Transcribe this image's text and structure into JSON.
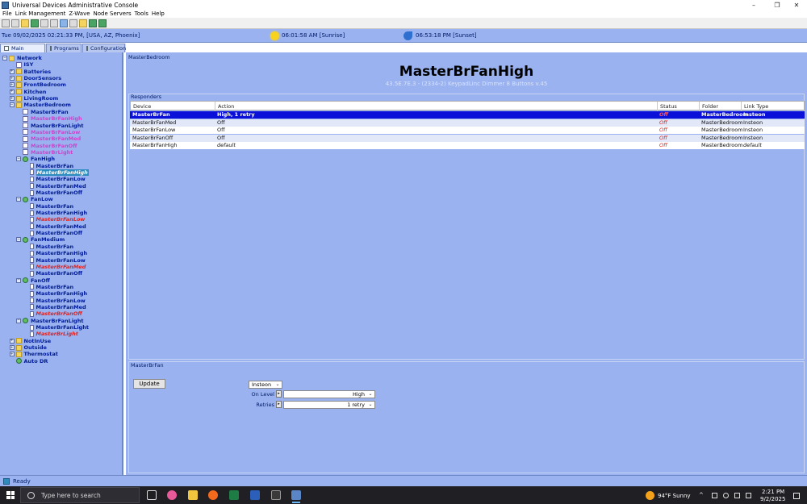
{
  "window": {
    "title": "Universal Devices Administrative Console",
    "controls": [
      "–",
      "❐",
      "✕"
    ]
  },
  "menu": [
    "File",
    "Link Management",
    "Z-Wave",
    "Node Servers",
    "Tools",
    "Help"
  ],
  "infobar": {
    "datetime": "Tue 09/02/2025 02:21:33 PM, [USA, AZ, Phoenix]",
    "sunrise": "06:01:58 AM [Sunrise]",
    "sunset": "06:53:18 PM [Sunset]"
  },
  "tabs": [
    "Main",
    "Programs",
    "Configuration"
  ],
  "tree": [
    {
      "label": "Network",
      "indent": 0,
      "toggle": "−",
      "icon": "net",
      "style": "normal"
    },
    {
      "label": "ISY",
      "indent": 1,
      "toggle": "",
      "icon": "dev",
      "style": "normal"
    },
    {
      "label": "Batteries",
      "indent": 1,
      "toggle": "+",
      "icon": "folder",
      "style": "normal"
    },
    {
      "label": "DoorSensors",
      "indent": 1,
      "toggle": "+",
      "icon": "folder",
      "style": "normal"
    },
    {
      "label": "FrontBedroom",
      "indent": 1,
      "toggle": "+",
      "icon": "folder",
      "style": "normal"
    },
    {
      "label": "Kitchen",
      "indent": 1,
      "toggle": "+",
      "icon": "folder",
      "style": "normal"
    },
    {
      "label": "LivingRoom",
      "indent": 1,
      "toggle": "+",
      "icon": "folder",
      "style": "normal"
    },
    {
      "label": "MasterBedroom",
      "indent": 1,
      "toggle": "−",
      "icon": "folder",
      "style": "normal"
    },
    {
      "label": "MasterBrFan",
      "indent": 2,
      "toggle": "",
      "icon": "dev",
      "style": "normal"
    },
    {
      "label": "MasterBrFanHigh",
      "indent": 2,
      "toggle": "",
      "icon": "dev",
      "style": "pink"
    },
    {
      "label": "MasterBrFanLight",
      "indent": 2,
      "toggle": "",
      "icon": "dev",
      "style": "normal"
    },
    {
      "label": "MasterBrFanLow",
      "indent": 2,
      "toggle": "",
      "icon": "dev",
      "style": "pink"
    },
    {
      "label": "MasterBrFanMed",
      "indent": 2,
      "toggle": "",
      "icon": "dev",
      "style": "pink"
    },
    {
      "label": "MasterBrFanOff",
      "indent": 2,
      "toggle": "",
      "icon": "dev",
      "style": "pink"
    },
    {
      "label": "MasterBrLight",
      "indent": 2,
      "toggle": "",
      "icon": "dev",
      "style": "pink"
    },
    {
      "label": "FanHigh",
      "indent": 2,
      "toggle": "−",
      "icon": "scene",
      "style": "normal"
    },
    {
      "label": "MasterBrFan",
      "indent": 3,
      "toggle": "",
      "icon": "small",
      "style": "normal"
    },
    {
      "label": "MasterBrFanHigh",
      "indent": 3,
      "toggle": "",
      "icon": "small",
      "style": "sel"
    },
    {
      "label": "MasterBrFanLow",
      "indent": 3,
      "toggle": "",
      "icon": "small",
      "style": "normal"
    },
    {
      "label": "MasterBrFanMed",
      "indent": 3,
      "toggle": "",
      "icon": "small",
      "style": "normal"
    },
    {
      "label": "MasterBrFanOff",
      "indent": 3,
      "toggle": "",
      "icon": "small",
      "style": "normal"
    },
    {
      "label": "FanLow",
      "indent": 2,
      "toggle": "−",
      "icon": "scene",
      "style": "normal"
    },
    {
      "label": "MasterBrFan",
      "indent": 3,
      "toggle": "",
      "icon": "small",
      "style": "normal"
    },
    {
      "label": "MasterBrFanHigh",
      "indent": 3,
      "toggle": "",
      "icon": "small",
      "style": "normal"
    },
    {
      "label": "MasterBrFanLow",
      "indent": 3,
      "toggle": "",
      "icon": "small",
      "style": "red"
    },
    {
      "label": "MasterBrFanMed",
      "indent": 3,
      "toggle": "",
      "icon": "small",
      "style": "normal"
    },
    {
      "label": "MasterBrFanOff",
      "indent": 3,
      "toggle": "",
      "icon": "small",
      "style": "normal"
    },
    {
      "label": "FanMedium",
      "indent": 2,
      "toggle": "−",
      "icon": "scene",
      "style": "normal"
    },
    {
      "label": "MasterBrFan",
      "indent": 3,
      "toggle": "",
      "icon": "small",
      "style": "normal"
    },
    {
      "label": "MasterBrFanHigh",
      "indent": 3,
      "toggle": "",
      "icon": "small",
      "style": "normal"
    },
    {
      "label": "MasterBrFanLow",
      "indent": 3,
      "toggle": "",
      "icon": "small",
      "style": "normal"
    },
    {
      "label": "MasterBrFanMed",
      "indent": 3,
      "toggle": "",
      "icon": "small",
      "style": "red"
    },
    {
      "label": "MasterBrFanOff",
      "indent": 3,
      "toggle": "",
      "icon": "small",
      "style": "normal"
    },
    {
      "label": "FanOff",
      "indent": 2,
      "toggle": "−",
      "icon": "scene",
      "style": "normal"
    },
    {
      "label": "MasterBrFan",
      "indent": 3,
      "toggle": "",
      "icon": "small",
      "style": "normal"
    },
    {
      "label": "MasterBrFanHigh",
      "indent": 3,
      "toggle": "",
      "icon": "small",
      "style": "normal"
    },
    {
      "label": "MasterBrFanLow",
      "indent": 3,
      "toggle": "",
      "icon": "small",
      "style": "normal"
    },
    {
      "label": "MasterBrFanMed",
      "indent": 3,
      "toggle": "",
      "icon": "small",
      "style": "normal"
    },
    {
      "label": "MasterBrFanOff",
      "indent": 3,
      "toggle": "",
      "icon": "small",
      "style": "red"
    },
    {
      "label": "MasterBrFanLight",
      "indent": 2,
      "toggle": "−",
      "icon": "scene",
      "style": "normal"
    },
    {
      "label": "MasterBrFanLight",
      "indent": 3,
      "toggle": "",
      "icon": "small",
      "style": "normal"
    },
    {
      "label": "MasterBrLight",
      "indent": 3,
      "toggle": "",
      "icon": "small",
      "style": "red"
    },
    {
      "label": "NotInUse",
      "indent": 1,
      "toggle": "+",
      "icon": "folder",
      "style": "normal"
    },
    {
      "label": "Outside",
      "indent": 1,
      "toggle": "+",
      "icon": "folder",
      "style": "normal"
    },
    {
      "label": "Thermostat",
      "indent": 1,
      "toggle": "+",
      "icon": "folder",
      "style": "normal"
    },
    {
      "label": "Auto DR",
      "indent": 1,
      "toggle": "",
      "icon": "scene",
      "style": "normal"
    }
  ],
  "detail": {
    "breadcrumb": "MasterBedroom",
    "title": "MasterBrFanHigh",
    "subtitle": "43.5E.7E.3 - (2334-2) KeypadLinc Dimmer 8 Buttons v.45",
    "responders_label": "Responders",
    "columns": [
      "Device",
      "Action",
      "Status",
      "Folder",
      "Link Type"
    ],
    "rows": [
      {
        "device": "MasterBrFan",
        "action": "High, 1 retry",
        "status": "Off",
        "folder": "MasterBedroom",
        "link": "Insteon",
        "kind": "selected"
      },
      {
        "device": "MasterBrFanMed",
        "action": "Off",
        "status": "Off",
        "folder": "MasterBedroom",
        "link": "Insteon",
        "kind": "alt"
      },
      {
        "device": "MasterBrFanLow",
        "action": "Off",
        "status": "Off",
        "folder": "MasterBedroom",
        "link": "Insteon",
        "kind": "plain"
      },
      {
        "device": "MasterBrFanOff",
        "action": "Off",
        "status": "Off",
        "folder": "MasterBedroom",
        "link": "Insteon",
        "kind": "alt"
      },
      {
        "device": "MasterBrFanHigh",
        "action": "default",
        "status": "Off",
        "folder": "MasterBedroom",
        "link": "default",
        "kind": "plain-italic"
      }
    ],
    "editor": {
      "label": "MasterBrFan",
      "update_button": "Update",
      "protocol": "Insteon",
      "on_level_label": "On Level",
      "on_level_value": "High",
      "retries_label": "Retries",
      "retries_value": "1 retry"
    }
  },
  "status": "Ready",
  "taskbar": {
    "search_placeholder": "Type here to search",
    "weather": "94°F  Sunny",
    "time": "2:21 PM",
    "date": "9/2/2025"
  }
}
